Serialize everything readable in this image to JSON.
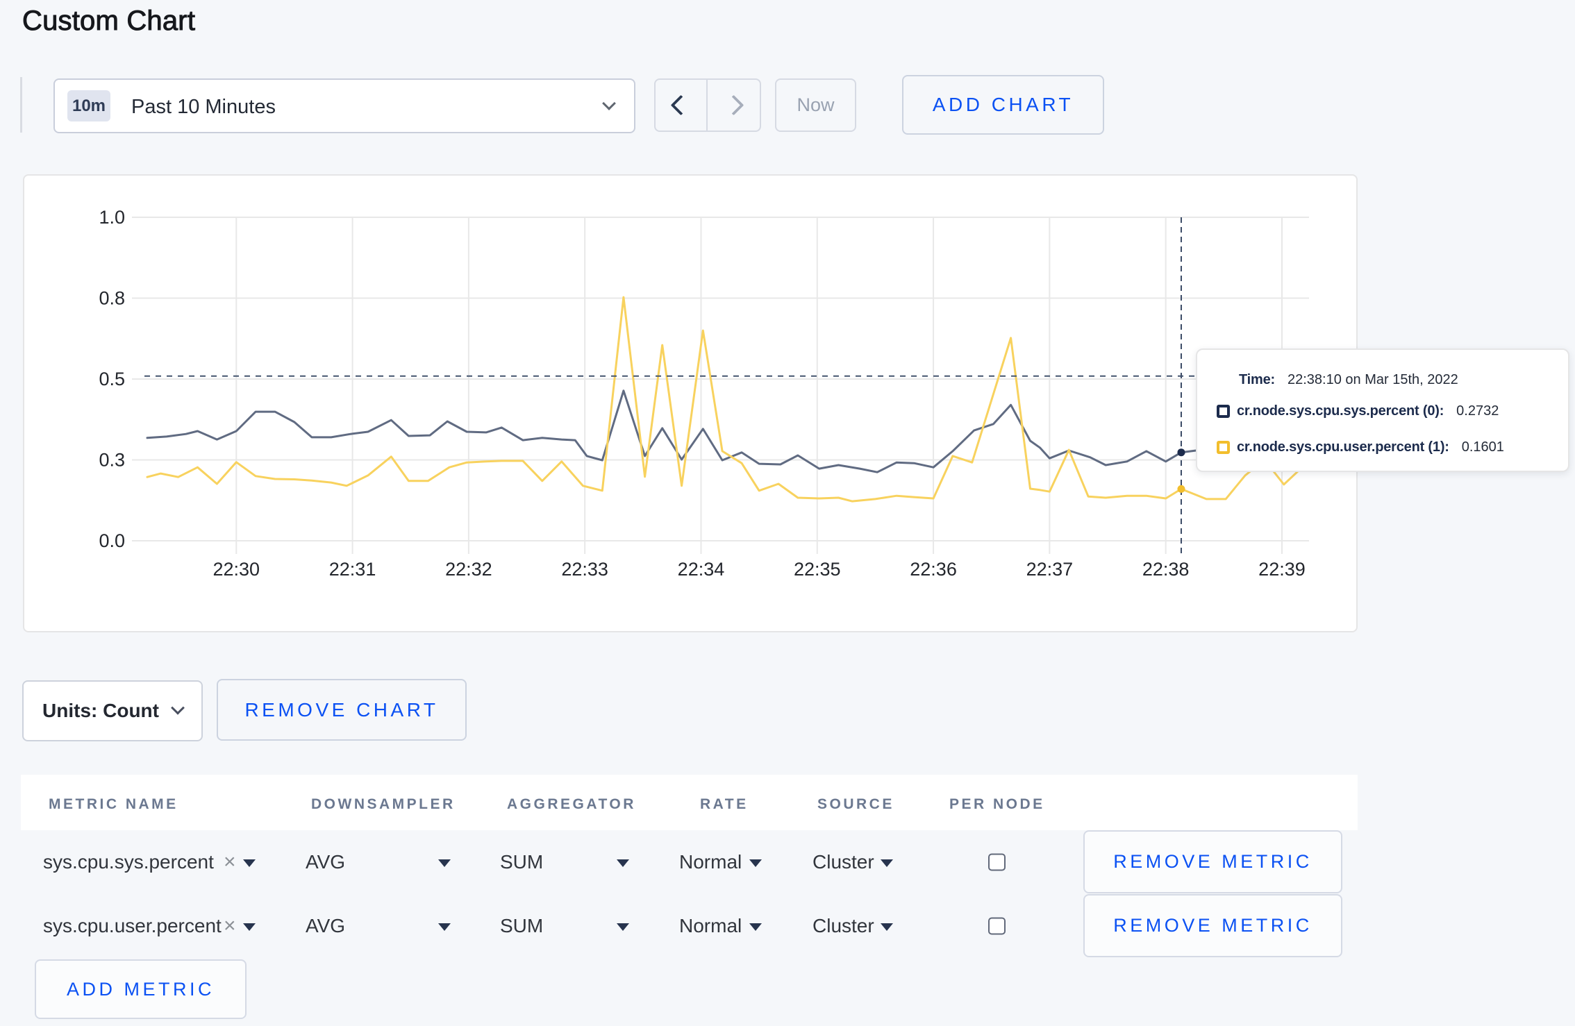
{
  "page": {
    "title": "Custom Chart"
  },
  "toolbar": {
    "range_badge": "10m",
    "range_label": "Past 10 Minutes",
    "now_label": "Now",
    "add_chart_label": "ADD CHART"
  },
  "chart_data": {
    "type": "line",
    "title": "",
    "x_domain": [
      "22:29:14",
      "22:39:14"
    ],
    "window_seconds": 600,
    "ylim": [
      0,
      1
    ],
    "grid": true,
    "y_ticks": [
      {
        "v": 0,
        "label": "0.0"
      },
      {
        "v": 0.25,
        "label": "0.3"
      },
      {
        "v": 0.5,
        "label": "0.5"
      },
      {
        "v": 0.75,
        "label": "0.8"
      },
      {
        "v": 1,
        "label": "1.0"
      }
    ],
    "x_ticks": [
      {
        "t": 46,
        "label": "22:30"
      },
      {
        "t": 106,
        "label": "22:31"
      },
      {
        "t": 166,
        "label": "22:32"
      },
      {
        "t": 226,
        "label": "22:33"
      },
      {
        "t": 286,
        "label": "22:34"
      },
      {
        "t": 346,
        "label": "22:35"
      },
      {
        "t": 406,
        "label": "22:36"
      },
      {
        "t": 466,
        "label": "22:37"
      },
      {
        "t": 526,
        "label": "22:38"
      },
      {
        "t": 586,
        "label": "22:39"
      }
    ],
    "series": [
      {
        "name": "cr.node.sys.cpu.sys.percent (0)",
        "color": "#606b82",
        "swatch": "#1c2b4c",
        "points": [
          [
            0,
            0.318
          ],
          [
            10,
            0.322
          ],
          [
            20,
            0.33
          ],
          [
            26,
            0.339
          ],
          [
            36,
            0.313
          ],
          [
            46,
            0.339
          ],
          [
            56,
            0.399
          ],
          [
            66,
            0.399
          ],
          [
            76,
            0.367
          ],
          [
            85,
            0.32
          ],
          [
            95,
            0.32
          ],
          [
            105,
            0.33
          ],
          [
            114,
            0.337
          ],
          [
            126,
            0.373
          ],
          [
            135,
            0.324
          ],
          [
            146,
            0.326
          ],
          [
            155,
            0.369
          ],
          [
            165,
            0.337
          ],
          [
            175,
            0.335
          ],
          [
            183,
            0.35
          ],
          [
            194,
            0.311
          ],
          [
            204,
            0.318
          ],
          [
            214,
            0.313
          ],
          [
            221,
            0.311
          ],
          [
            227,
            0.262
          ],
          [
            235,
            0.249
          ],
          [
            246,
            0.464
          ],
          [
            257,
            0.262
          ],
          [
            266,
            0.348
          ],
          [
            276,
            0.251
          ],
          [
            287,
            0.346
          ],
          [
            297,
            0.249
          ],
          [
            307,
            0.273
          ],
          [
            316,
            0.238
          ],
          [
            327,
            0.236
          ],
          [
            336,
            0.264
          ],
          [
            347,
            0.223
          ],
          [
            357,
            0.234
          ],
          [
            368,
            0.223
          ],
          [
            377,
            0.212
          ],
          [
            387,
            0.242
          ],
          [
            396,
            0.24
          ],
          [
            406,
            0.227
          ],
          [
            416,
            0.277
          ],
          [
            427,
            0.341
          ],
          [
            437,
            0.361
          ],
          [
            446,
            0.42
          ],
          [
            456,
            0.309
          ],
          [
            461,
            0.288
          ],
          [
            466,
            0.255
          ],
          [
            476,
            0.279
          ],
          [
            487,
            0.258
          ],
          [
            495,
            0.234
          ],
          [
            506,
            0.245
          ],
          [
            516,
            0.277
          ],
          [
            526,
            0.245
          ],
          [
            534,
            0.2732
          ],
          [
            544,
            0.281
          ],
          [
            557,
            0.3
          ],
          [
            567,
            0.291
          ],
          [
            577,
            0.282
          ],
          [
            587,
            0.3
          ],
          [
            600,
            0.31
          ]
        ]
      },
      {
        "name": "cr.node.sys.cpu.user.percent (1)",
        "color": "#f8d25e",
        "swatch": "#f2be2d",
        "points": [
          [
            0,
            0.197
          ],
          [
            7,
            0.208
          ],
          [
            16,
            0.197
          ],
          [
            26,
            0.227
          ],
          [
            36,
            0.176
          ],
          [
            46,
            0.243
          ],
          [
            56,
            0.2
          ],
          [
            66,
            0.191
          ],
          [
            76,
            0.19
          ],
          [
            85,
            0.186
          ],
          [
            95,
            0.18
          ],
          [
            103,
            0.17
          ],
          [
            114,
            0.202
          ],
          [
            126,
            0.26
          ],
          [
            135,
            0.185
          ],
          [
            145,
            0.185
          ],
          [
            156,
            0.227
          ],
          [
            165,
            0.242
          ],
          [
            175,
            0.245
          ],
          [
            183,
            0.247
          ],
          [
            194,
            0.247
          ],
          [
            204,
            0.185
          ],
          [
            214,
            0.245
          ],
          [
            225,
            0.17
          ],
          [
            235,
            0.155
          ],
          [
            246,
            0.753
          ],
          [
            257,
            0.198
          ],
          [
            266,
            0.605
          ],
          [
            276,
            0.17
          ],
          [
            287,
            0.65
          ],
          [
            297,
            0.277
          ],
          [
            307,
            0.24
          ],
          [
            316,
            0.155
          ],
          [
            326,
            0.176
          ],
          [
            336,
            0.133
          ],
          [
            347,
            0.131
          ],
          [
            357,
            0.133
          ],
          [
            364,
            0.122
          ],
          [
            376,
            0.129
          ],
          [
            387,
            0.139
          ],
          [
            396,
            0.135
          ],
          [
            406,
            0.131
          ],
          [
            416,
            0.262
          ],
          [
            426,
            0.242
          ],
          [
            446,
            0.627
          ],
          [
            456,
            0.161
          ],
          [
            461,
            0.157
          ],
          [
            466,
            0.152
          ],
          [
            476,
            0.281
          ],
          [
            486,
            0.137
          ],
          [
            495,
            0.133
          ],
          [
            506,
            0.139
          ],
          [
            516,
            0.139
          ],
          [
            526,
            0.131
          ],
          [
            534,
            0.1601
          ],
          [
            547,
            0.129
          ],
          [
            557,
            0.129
          ],
          [
            567,
            0.202
          ],
          [
            577,
            0.25
          ],
          [
            587,
            0.174
          ],
          [
            597,
            0.23
          ],
          [
            600,
            0.24
          ]
        ]
      }
    ],
    "hover": {
      "t": 534,
      "crosshair_v": 0.509,
      "dots": [
        0.2732,
        0.1601
      ]
    }
  },
  "tooltip": {
    "time_label": "Time:",
    "time_value": "22:38:10 on Mar 15th, 2022",
    "rows": [
      {
        "label": "cr.node.sys.cpu.sys.percent (0):",
        "value": "0.2732"
      },
      {
        "label": "cr.node.sys.cpu.user.percent (1):",
        "value": "0.1601"
      }
    ]
  },
  "units": {
    "label": "Units: Count"
  },
  "actions": {
    "remove_chart": "REMOVE CHART",
    "remove_metric": "REMOVE METRIC",
    "add_metric": "ADD METRIC"
  },
  "table": {
    "headers": [
      "METRIC NAME",
      "DOWNSAMPLER",
      "AGGREGATOR",
      "RATE",
      "SOURCE",
      "PER NODE"
    ],
    "rows": [
      {
        "metric": "sys.cpu.sys.percent",
        "downsampler": "AVG",
        "aggregator": "SUM",
        "rate": "Normal",
        "source": "Cluster",
        "per_node_checked": false
      },
      {
        "metric": "sys.cpu.user.percent",
        "downsampler": "AVG",
        "aggregator": "SUM",
        "rate": "Normal",
        "source": "Cluster",
        "per_node_checked": false
      }
    ]
  },
  "colors": {
    "page_bg": "#f5f7fa",
    "accent_blue": "#0b51f3",
    "series0": "#606b82",
    "series1": "#f8d25e"
  }
}
